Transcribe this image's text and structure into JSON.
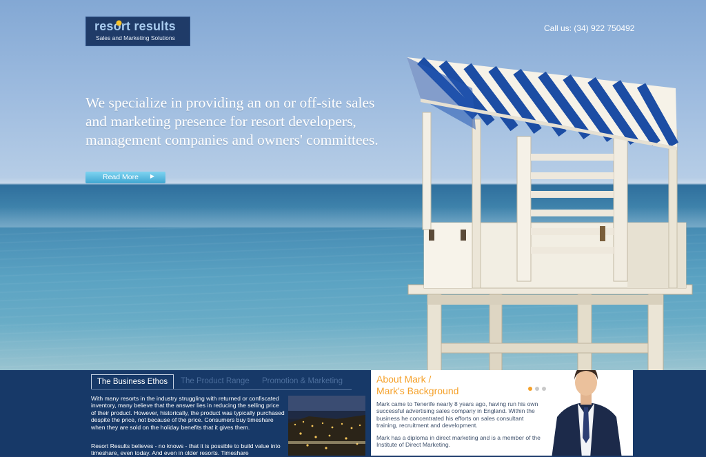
{
  "header": {
    "logo_text": "resort results",
    "logo_tagline": "Sales and Marketing Solutions",
    "call_us": "Call us: (34) 922 750492"
  },
  "hero": {
    "headline": "We specialize in providing an on or off-site sales and marketing presence for resort developers, management companies and owners' committees.",
    "read_more_label": "Read More",
    "read_more_arrow": "▶"
  },
  "tabs": [
    {
      "label": "The Business Ethos",
      "active": true
    },
    {
      "label": "The Product Range",
      "active": false
    },
    {
      "label": "Promotion & Marketing",
      "active": false
    }
  ],
  "ethos": {
    "paragraph1": "With many resorts in the industry struggling with returned or confiscated inventory, many believe that the answer lies in reducing the selling price of their product. However, historically, the product was typically purchased despite the price, not because of the price. Consumers buy timeshare when they are sold on the holiday benefits that it gives them.",
    "paragraph2": "Resort Results believes - no knows - that it is possible to build value into timeshare, even today. And even in older resorts. Timeshare"
  },
  "about": {
    "title_line1": "About Mark /",
    "title_line2": "Mark's Background",
    "paragraph1": "Mark came to Tenerife nearly 8 years ago, having run his own successful advertising sales company in England. Within the business he concentrated his efforts on sales consultant training, recruitment and development.",
    "paragraph2": "Mark has a diploma in direct marketing and is a member of the Institute of Direct Marketing.",
    "slides": 3,
    "active_slide": 1
  },
  "colors": {
    "navy": "#173968",
    "accent_orange": "#f5a12a",
    "button_blue": "#3fa6d2",
    "logo_blue": "#a8cbee"
  },
  "icons": [
    "sun-dot-icon",
    "arrow-right-icon",
    "carousel-dot-icon"
  ]
}
